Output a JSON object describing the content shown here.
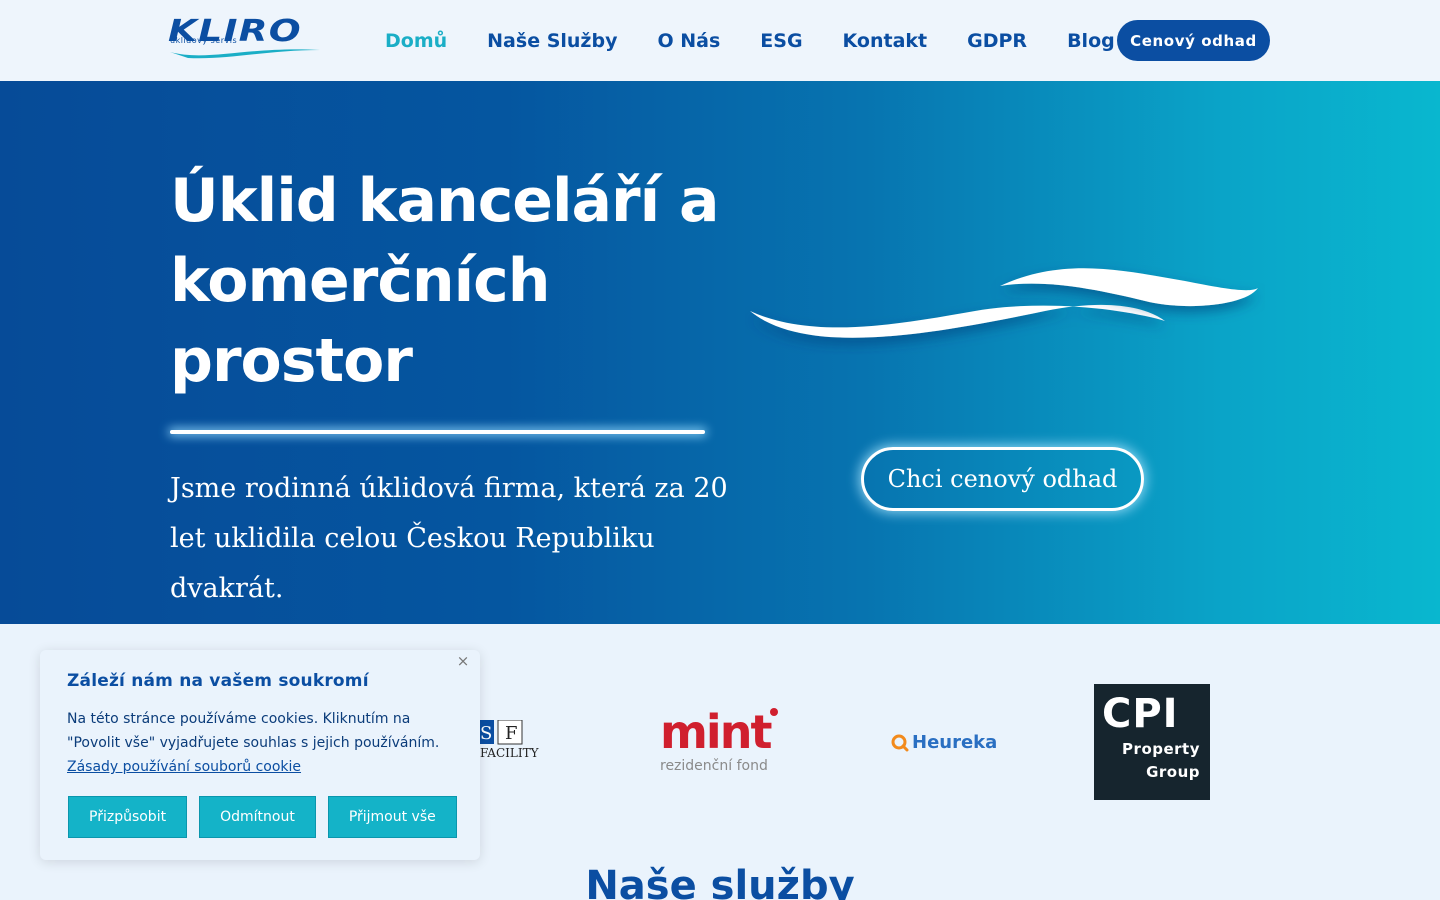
{
  "header": {
    "logo_text": "KLIRO",
    "logo_subtext": "úklidový servis",
    "nav": [
      {
        "label": "Domů",
        "active": true
      },
      {
        "label": "Naše Služby"
      },
      {
        "label": "O Nás"
      },
      {
        "label": "ESG"
      },
      {
        "label": "Kontakt"
      },
      {
        "label": "GDPR"
      },
      {
        "label": "Blog"
      }
    ],
    "cta_label": "Cenový odhad"
  },
  "hero": {
    "title": "Úklid kanceláří a komerčních prostor",
    "subtitle": "Jsme rodinná úklidová firma, která za 20 let uklidila celou Českou Republiku dvakrát.",
    "cta_label": "Chci cenový odhad"
  },
  "partners": {
    "sif": "SIF",
    "sif_sub": "FACILITY",
    "mint": "mint",
    "mint_sub": "rezidenční fond",
    "heureka": "Heureka",
    "cpi": "CPI",
    "cpi_sub1": "Property",
    "cpi_sub2": "Group"
  },
  "section_title": "Naše služby",
  "cookie": {
    "title": "Záleží nám na vašem soukromí",
    "text": "Na této stránce používáme cookies. Kliknutím na \"Povolit vše\" vyjadřujete souhlas s jejich používáním.",
    "link": "Zásady používání souborů cookie",
    "close": "×",
    "buttons": {
      "customize": "Přizpůsobit",
      "reject": "Odmítnout",
      "accept": "Přijmout vše"
    }
  },
  "colors": {
    "brand": "#0b4ea2",
    "accent": "#1aaec6",
    "cookie_button": "#14b3c8"
  }
}
